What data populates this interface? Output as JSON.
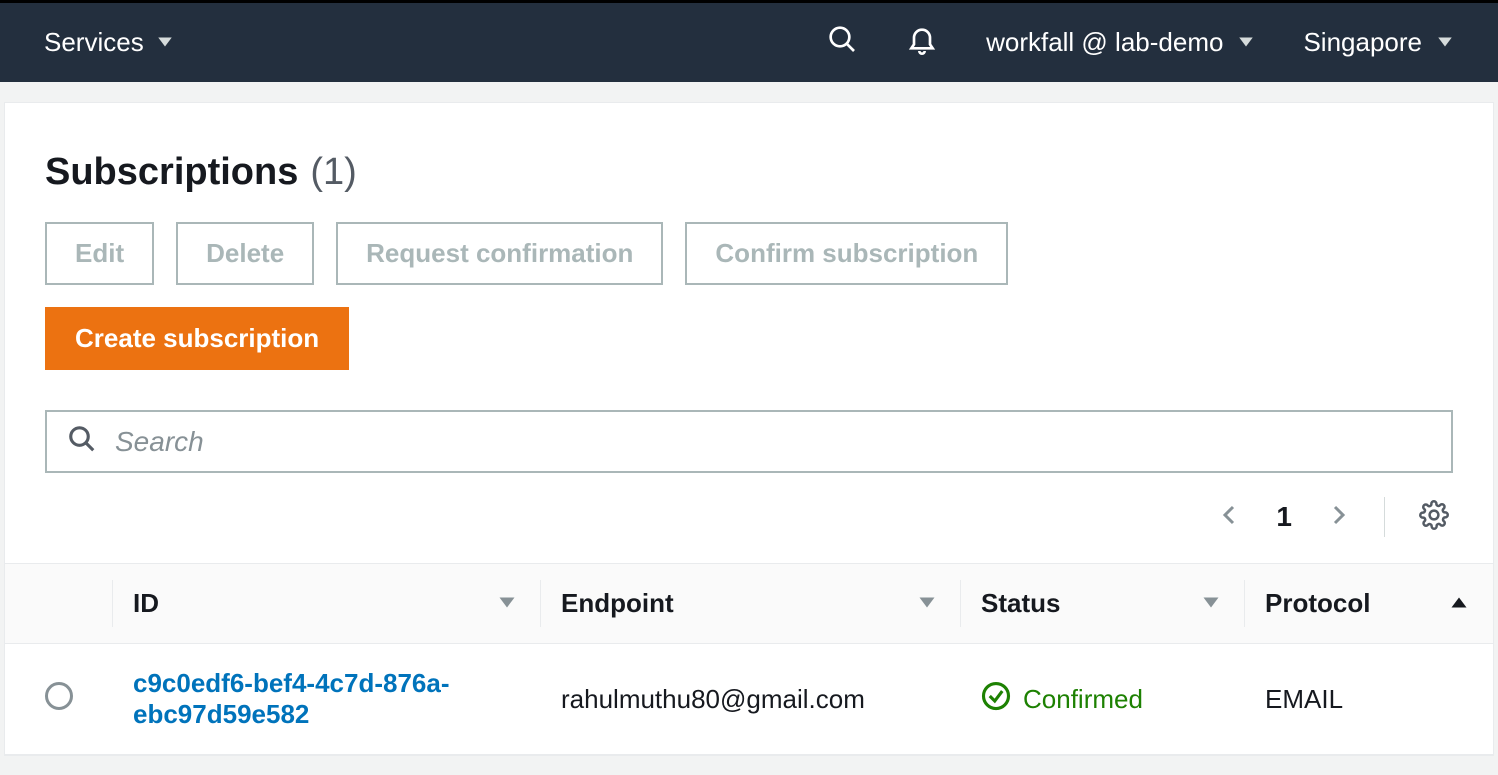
{
  "nav": {
    "services_label": "Services",
    "account_label": "workfall @ lab-demo",
    "region_label": "Singapore"
  },
  "page": {
    "title": "Subscriptions",
    "count": "(1)"
  },
  "actions": {
    "edit": "Edit",
    "delete": "Delete",
    "request_confirmation": "Request confirmation",
    "confirm_subscription": "Confirm subscription",
    "create_subscription": "Create subscription"
  },
  "search": {
    "placeholder": "Search"
  },
  "pagination": {
    "page": "1"
  },
  "table": {
    "columns": {
      "id": "ID",
      "endpoint": "Endpoint",
      "status": "Status",
      "protocol": "Protocol"
    },
    "rows": [
      {
        "id": "c9c0edf6-bef4-4c7d-876a-ebc97d59e582",
        "endpoint": "rahulmuthu80@gmail.com",
        "status": "Confirmed",
        "protocol": "EMAIL"
      }
    ]
  }
}
